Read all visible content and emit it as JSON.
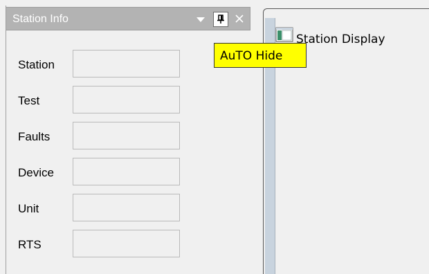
{
  "panel": {
    "title": "Station Info",
    "fields": [
      {
        "label": "Station",
        "value": ""
      },
      {
        "label": "Test",
        "value": ""
      },
      {
        "label": "Faults",
        "value": ""
      },
      {
        "label": "Device",
        "value": ""
      },
      {
        "label": "Unit",
        "value": ""
      },
      {
        "label": "RTS",
        "value": ""
      }
    ]
  },
  "tooltip": {
    "text": "AuTO Hide"
  },
  "document": {
    "title": "Station Display"
  },
  "icons": {
    "dropdown": "chevron-down-icon",
    "pin": "pin-icon",
    "close": "close-icon",
    "window": "window-icon"
  },
  "colors": {
    "panel_header": "#b3b3b3",
    "tooltip_bg": "#ffff00",
    "background": "#f0f0f0"
  }
}
